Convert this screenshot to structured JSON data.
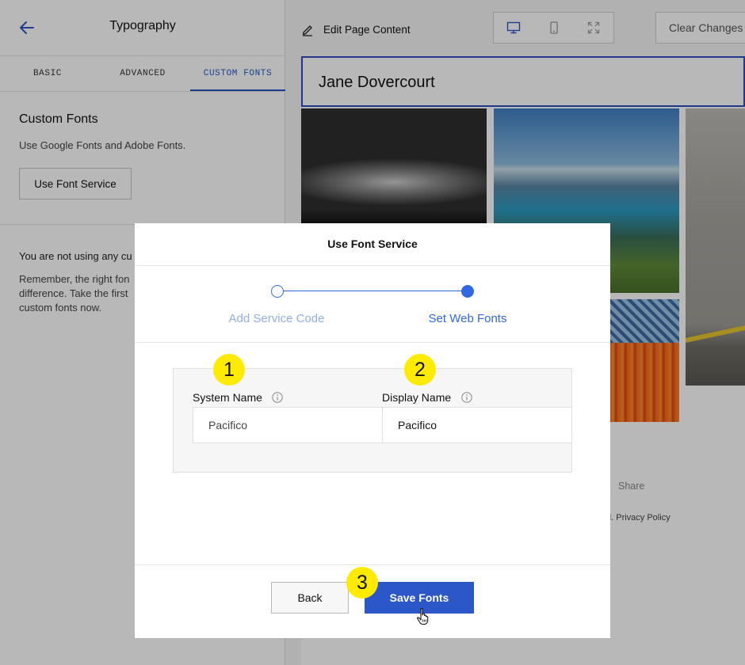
{
  "sidebar": {
    "title": "Typography",
    "tabs": [
      {
        "label": "BASIC",
        "active": false
      },
      {
        "label": "ADVANCED",
        "active": false
      },
      {
        "label": "CUSTOM FONTS",
        "active": true
      }
    ],
    "section_title": "Custom Fonts",
    "section_desc": "Use Google Fonts and Adobe Fonts.",
    "use_font_service_label": "Use Font Service",
    "notice_text": "You are not using any cu",
    "tip_lines": [
      "Remember, the right fon",
      "difference. Take the first",
      "custom fonts now."
    ]
  },
  "editor": {
    "edit_page_label": "Edit Page Content",
    "devices": [
      "desktop-icon",
      "mobile-icon",
      "fullscreen-icon"
    ],
    "clear_changes_label": "Clear Changes",
    "site_title": "Jane Dovercourt",
    "share_label": "Share",
    "footer_text": "d. Privacy Policy"
  },
  "modal": {
    "title": "Use Font Service",
    "steps": [
      {
        "label": "Add Service Code",
        "complete": true,
        "current": false
      },
      {
        "label": "Set Web Fonts",
        "complete": false,
        "current": true
      }
    ],
    "system_name_label": "System Name",
    "system_name_value": "Pacifico",
    "display_name_label": "Display Name",
    "display_name_value": "Pacifico",
    "back_label": "Back",
    "save_label": "Save Fonts"
  },
  "markers": [
    "1",
    "2",
    "3"
  ],
  "colors": {
    "accent": "#2b57c9",
    "step_active": "#2f68e0",
    "step_inactive": "#8fb0e6",
    "marker": "#ffeb00"
  }
}
